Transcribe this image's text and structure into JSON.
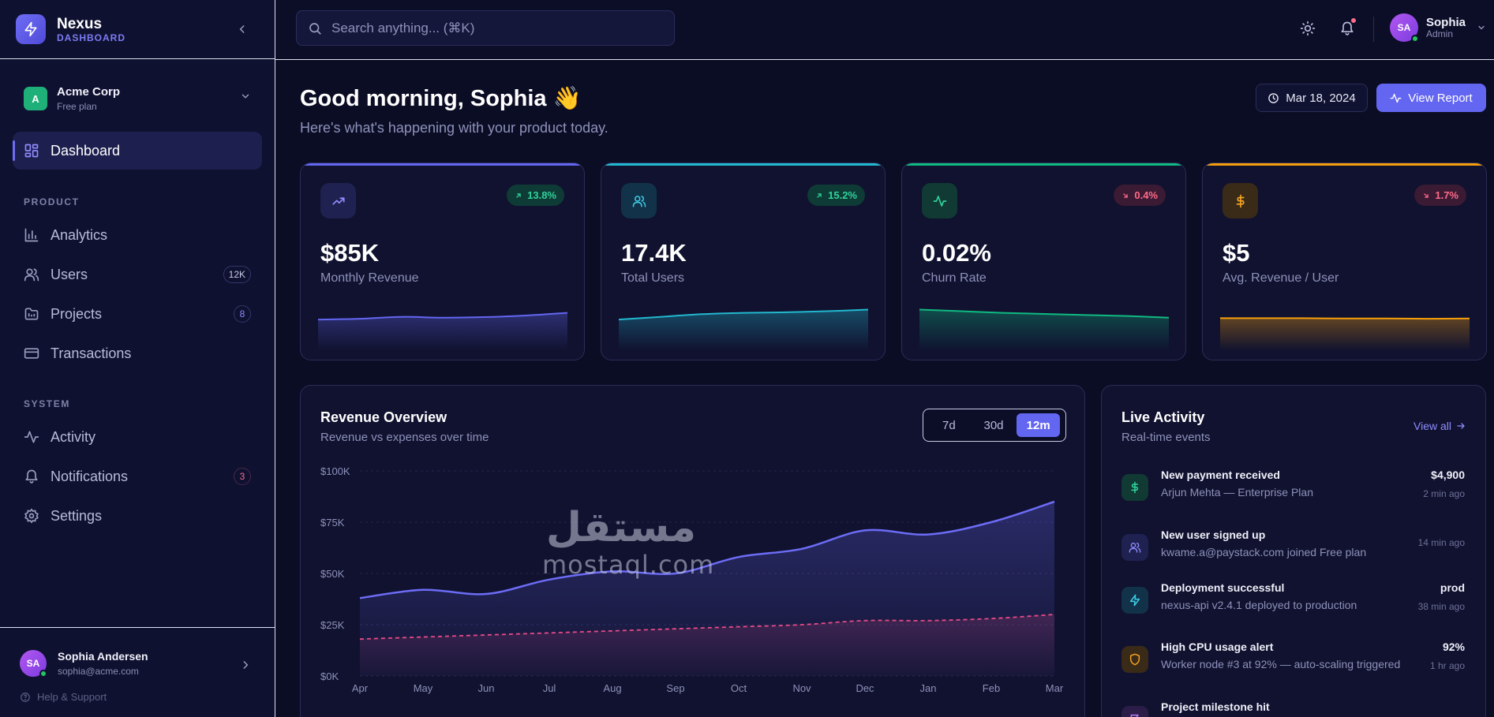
{
  "brand": {
    "name": "Nexus",
    "subtitle": "DASHBOARD"
  },
  "workspace": {
    "initial": "A",
    "name": "Acme Corp",
    "plan": "Free plan"
  },
  "nav": {
    "active": {
      "label": "Dashboard",
      "icon": "grid-icon"
    },
    "sections": [
      {
        "title": "PRODUCT",
        "items": [
          {
            "label": "Analytics",
            "icon": "bar-chart-icon",
            "badge": ""
          },
          {
            "label": "Users",
            "icon": "users-icon",
            "badge": "12K"
          },
          {
            "label": "Projects",
            "icon": "folder-icon",
            "badge": "8"
          },
          {
            "label": "Transactions",
            "icon": "credit-card-icon",
            "badge": ""
          }
        ]
      },
      {
        "title": "SYSTEM",
        "items": [
          {
            "label": "Activity",
            "icon": "activity-icon",
            "badge": ""
          },
          {
            "label": "Notifications",
            "icon": "bell-icon",
            "badge": "3"
          },
          {
            "label": "Settings",
            "icon": "gear-icon",
            "badge": ""
          }
        ]
      }
    ]
  },
  "sidebar_user": {
    "initials": "SA",
    "name": "Sophia Andersen",
    "email": "sophia@acme.com",
    "help": "Help & Support"
  },
  "search": {
    "placeholder": "Search anything... (⌘K)"
  },
  "topbar_user": {
    "initials": "SA",
    "name": "Sophia",
    "role": "Admin"
  },
  "header": {
    "greeting": "Good morning, Sophia 👋",
    "subtitle": "Here's what's happening with your product today.",
    "date": "Mar 18, 2024",
    "report_button": "View Report"
  },
  "kpis": [
    {
      "value": "$85K",
      "label": "Monthly Revenue",
      "change": "13.8%",
      "direction": "up",
      "icon": "trending-up-icon",
      "color": "#6366f1",
      "spark": [
        0.35,
        0.38,
        0.45,
        0.42,
        0.44,
        0.5,
        0.6
      ]
    },
    {
      "value": "17.4K",
      "label": "Total Users",
      "change": "15.2%",
      "direction": "up",
      "icon": "users-icon",
      "color": "#22b8cf",
      "spark": [
        0.35,
        0.45,
        0.55,
        0.6,
        0.62,
        0.66,
        0.72
      ]
    },
    {
      "value": "0.02%",
      "label": "Churn Rate",
      "change": "0.4%",
      "direction": "down",
      "icon": "activity-icon",
      "color": "#10b981",
      "spark": [
        0.72,
        0.66,
        0.6,
        0.56,
        0.52,
        0.48,
        0.42
      ]
    },
    {
      "value": "$5",
      "label": "Avg. Revenue / User",
      "change": "1.7%",
      "direction": "down",
      "icon": "dollar-icon",
      "color": "#f59e0b",
      "spark": [
        0.4,
        0.4,
        0.4,
        0.39,
        0.39,
        0.38,
        0.39
      ]
    }
  ],
  "revenue_overview": {
    "title": "Revenue Overview",
    "subtitle": "Revenue vs expenses over time",
    "ranges": [
      "7d",
      "30d",
      "12m"
    ],
    "active_range": "12m"
  },
  "chart_data": {
    "type": "area",
    "title": "Revenue Overview",
    "categories": [
      "Apr",
      "May",
      "Jun",
      "Jul",
      "Aug",
      "Sep",
      "Oct",
      "Nov",
      "Dec",
      "Jan",
      "Feb",
      "Mar"
    ],
    "ylim": [
      0,
      100000
    ],
    "yticks": [
      "$0K",
      "$25K",
      "$50K",
      "$75K",
      "$100K"
    ],
    "grid": true,
    "series": [
      {
        "values": [
          38000,
          42000,
          40000,
          47000,
          51000,
          50000,
          58000,
          62000,
          71000,
          69000,
          75000,
          85000
        ],
        "color": "#6d6cf7",
        "style": "solid"
      },
      {
        "values": [
          18000,
          19000,
          20000,
          21000,
          22000,
          23000,
          24000,
          25000,
          27000,
          27000,
          28000,
          30000
        ],
        "color": "#e84a86",
        "style": "dashed"
      }
    ]
  },
  "live_activity": {
    "title": "Live Activity",
    "subtitle": "Real-time events",
    "view_all": "View all",
    "events": [
      {
        "title": "New payment received",
        "desc": "Arjun Mehta — Enterprise Plan",
        "value": "$4,900",
        "time": "2 min ago",
        "icon": "dollar-icon",
        "color": "#10b981"
      },
      {
        "title": "New user signed up",
        "desc": "kwame.a@paystack.com joined Free plan",
        "value": "",
        "time": "14 min ago",
        "icon": "users-icon",
        "color": "#6366f1"
      },
      {
        "title": "Deployment successful",
        "desc": "nexus-api v2.4.1 deployed to production",
        "value": "prod",
        "time": "38 min ago",
        "icon": "bolt-icon",
        "color": "#22b8cf"
      },
      {
        "title": "High CPU usage alert",
        "desc": "Worker node #3 at 92% — auto-scaling triggered",
        "value": "92%",
        "time": "1 hr ago",
        "icon": "shield-icon",
        "color": "#f59e0b"
      },
      {
        "title": "Project milestone hit",
        "desc": "",
        "value": "",
        "time": "",
        "icon": "flag-icon",
        "color": "#a855f7"
      }
    ]
  },
  "watermark": {
    "arabic": "مستقل",
    "latin": "mostaql.com"
  }
}
